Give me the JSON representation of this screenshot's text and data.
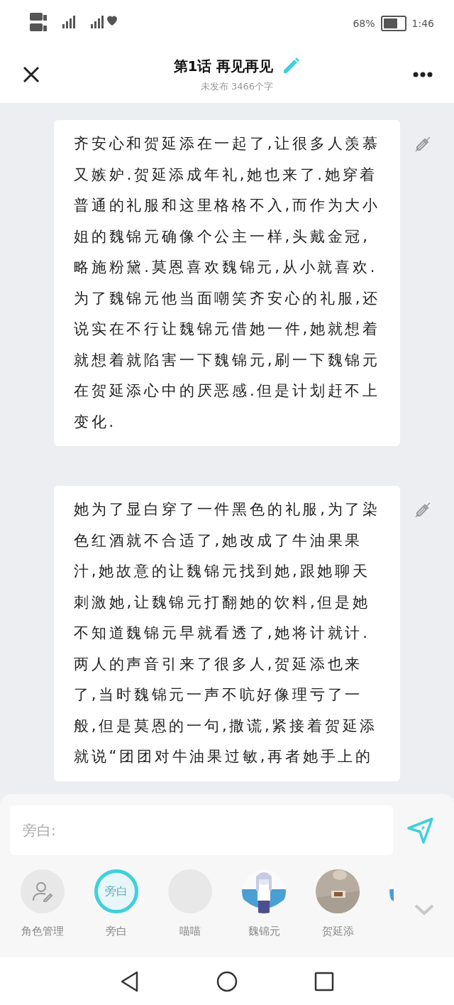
{
  "status_bar": {
    "battery_text": "68%",
    "time": "1:46"
  },
  "header": {
    "title": "第1话 再见再见",
    "subtitle": "未发布 3466个字"
  },
  "paragraphs": [
    {
      "text": "齐安心和贺延添在一起了,让很多人羡慕又嫉妒.贺延添成年礼,她也来了.她穿着普通的礼服和这里格格不入,而作为大小姐的魏锦元确像个公主一样,头戴金冠,略施粉黛.莫恩喜欢魏锦元,从小就喜欢.为了魏锦元他当面嘲笑齐安心的礼服,还说实在不行让魏锦元借她一件,她就想着就想着就陷害一下魏锦元,刷一下魏锦元在贺延添心中的厌恶感.但是计划赶不上变化."
    },
    {
      "text": "她为了显白穿了一件黑色的礼服,为了染色红酒就不合适了,她改成了牛油果果汁,她故意的让魏锦元找到她,跟她聊天刺激她,让魏锦元打翻她的饮料,但是她不知道魏锦元早就看透了,她将计就计.两人的声音引来了很多人,贺延添也来了,当时魏锦元一声不吭好像理亏了一般,但是莫恩的一句,撒谎,紧接着贺延添就说“团团对牛油果过敏,再者她手上的"
    }
  ],
  "composer": {
    "placeholder": "旁白:"
  },
  "characters": [
    {
      "kind": "manage",
      "name": "角色管理",
      "selected": false
    },
    {
      "kind": "text",
      "badge": "旁白",
      "name": "旁白",
      "selected": true
    },
    {
      "kind": "blank",
      "name": "喵喵",
      "selected": false
    },
    {
      "kind": "picture",
      "name": "魏锦元",
      "selected": false
    },
    {
      "kind": "picture",
      "name": "贺延添",
      "selected": false
    },
    {
      "kind": "picture",
      "selected": false
    }
  ]
}
